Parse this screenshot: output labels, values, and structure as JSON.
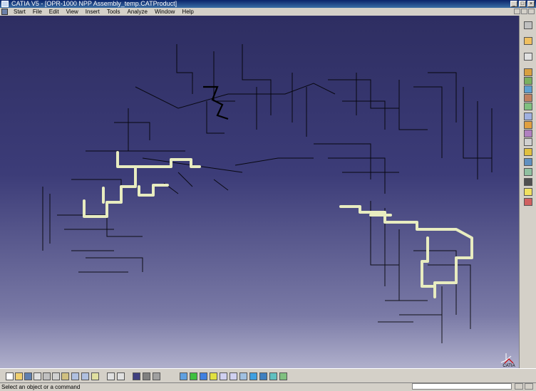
{
  "window": {
    "title": "CATIA V5 - [OPR-1000 NPP Assembly_temp.CATProduct]"
  },
  "menu": {
    "items": [
      "Start",
      "File",
      "Edit",
      "View",
      "Insert",
      "Tools",
      "Analyze",
      "Window",
      "Help"
    ]
  },
  "viewport": {
    "background_top": "#2e2e62",
    "background_bottom": "#b0b0cc",
    "pipe_color": "#000000",
    "highlight_pipe_color": "#e8ecc0"
  },
  "logo": {
    "text": "CATIA"
  },
  "status": {
    "message": "Select an object or a command",
    "command_value": ""
  }
}
